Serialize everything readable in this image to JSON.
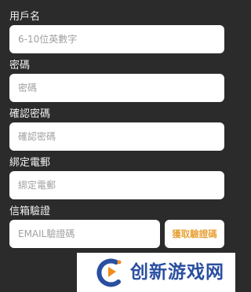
{
  "form": {
    "username": {
      "label": "用戶名",
      "placeholder": "6-10位英數字"
    },
    "password": {
      "label": "密碼",
      "placeholder": "密碼"
    },
    "confirm_password": {
      "label": "確認密碼",
      "placeholder": "確認密碼"
    },
    "email": {
      "label": "綁定電郵",
      "placeholder": "綁定電郵"
    },
    "email_verify": {
      "label": "信箱驗證",
      "placeholder": "EMAIL驗證碼",
      "send_button": "獲取驗證碼"
    }
  },
  "watermark": {
    "text": "创新游戏网"
  },
  "colors": {
    "background": "#2b2b2b",
    "field": "#ffffff",
    "accent": "#e8a33a",
    "watermark_blue": "#2a4fa0",
    "watermark_orange": "#f28a1c"
  }
}
